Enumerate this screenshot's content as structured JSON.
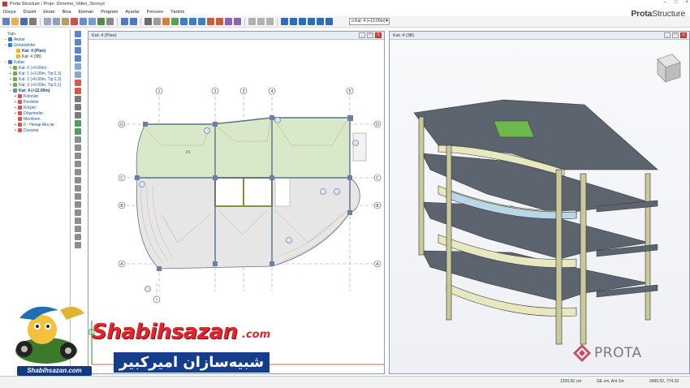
{
  "window": {
    "title": "Prota Structure / Proje: Deneme_Video_Storeys",
    "brand_bold": "Prota",
    "brand_rest": "Structure"
  },
  "menu": [
    "Dosya",
    "Düzelt",
    "Ekran",
    "Bina",
    "Eleman",
    "Program",
    "Ayarlar",
    "Pencere",
    "Yardım"
  ],
  "storey_selector": {
    "label": "Kat:",
    "value": "o Kat: 4 (+12.00m)"
  },
  "tree_panel": {
    "title": "Yapı",
    "rows": [
      {
        "exp": "−",
        "text": "Akslar",
        "icon_color": "#3a7bd5",
        "cls": ""
      },
      {
        "exp": "−",
        "text": "Görünümler",
        "icon_color": "#3a7bd5",
        "cls": ""
      },
      {
        "exp": "",
        "text": "Kat: 4 (Plan)",
        "icon_color": "#f0b429",
        "cls": "sel"
      },
      {
        "exp": "",
        "text": "Kat: 4 (3B)",
        "icon_color": "#f0b429",
        "cls": "dark"
      },
      {
        "exp": "−",
        "text": "Katlar",
        "icon_color": "#3a7bd5",
        "cls": ""
      },
      {
        "exp": "+",
        "text": "Kat: 0 (+0.00m)",
        "icon_color": "#7aa64a",
        "cls": ""
      },
      {
        "exp": "+",
        "text": "Kat: 1 (+3.00m, Tip:2,3)",
        "icon_color": "#7aa64a",
        "cls": ""
      },
      {
        "exp": "+",
        "text": "Kat: 2 (+6.00m, Tip:1,3)",
        "icon_color": "#7aa64a",
        "cls": ""
      },
      {
        "exp": "+",
        "text": "Kat: 3 (+9.00m, Tip:2,1)",
        "icon_color": "#7aa64a",
        "cls": ""
      },
      {
        "exp": "−",
        "text": "Kat: 4 (+12.00m)",
        "icon_color": "#3a9bd5",
        "cls": "sel"
      },
      {
        "exp": "+",
        "text": "Kolonlar",
        "icon_color": "#d9534f",
        "cls": ""
      },
      {
        "exp": "+",
        "text": "Perdeler",
        "icon_color": "#d9534f",
        "cls": ""
      },
      {
        "exp": "+",
        "text": "Kirişler",
        "icon_color": "#d9534f",
        "cls": ""
      },
      {
        "exp": "+",
        "text": "Döşemeler",
        "icon_color": "#d9534f",
        "cls": ""
      },
      {
        "exp": "",
        "text": "Merdiven",
        "icon_color": "#d9534f",
        "cls": ""
      },
      {
        "exp": "+",
        "text": "0 - Hesap Aks.lar",
        "icon_color": "#d9534f",
        "cls": ""
      },
      {
        "exp": "+",
        "text": "Duvarlar",
        "icon_color": "#d9534f",
        "cls": ""
      }
    ]
  },
  "plan_view": {
    "title": "Kat: 4 (Plan)",
    "axis_cols": [
      "1",
      "2",
      "3",
      "4",
      "5"
    ],
    "axis_rows": [
      "D",
      "C",
      "B",
      "A"
    ],
    "axis_extra": "I",
    "slab_label": "P1"
  },
  "view3d": {
    "title": "Kat: 4 (3B)"
  },
  "status": {
    "scale": "1200.00 cm",
    "mode": "GE cm, Ant 1m",
    "coords": "2495.52, 774.33"
  },
  "watermark": {
    "main": "Shabihsazan",
    "domain": ".com",
    "persian": "شبیه‌سازان امیرکبیر",
    "small": "Shabihsazan.com"
  },
  "prota_logo": "PROTA",
  "colors": {
    "accent": "#3a7bd5",
    "slab_green": "#d7e9c8",
    "wm_red": "#e3242b",
    "wm_blue": "#153e8a"
  }
}
